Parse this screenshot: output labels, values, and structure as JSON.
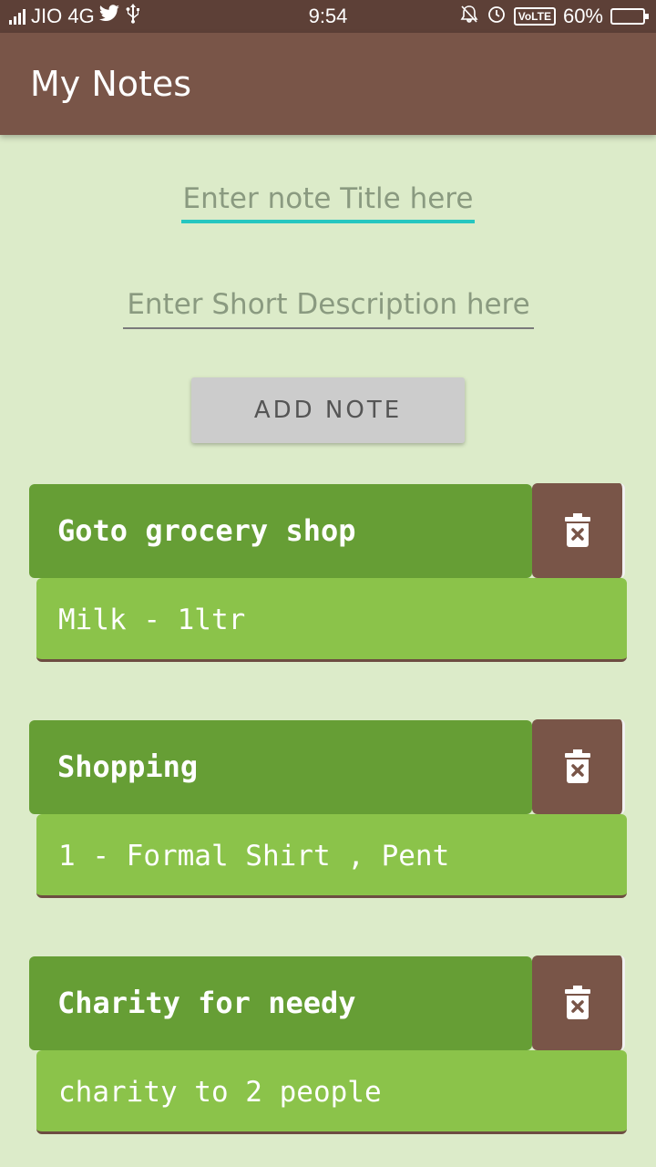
{
  "status_bar": {
    "carrier": "JIO 4G",
    "time": "9:54",
    "volte": "VoLTE",
    "battery": "60%",
    "battery_level": 0.6,
    "icons": [
      "signal-icon",
      "twitter-icon",
      "usb-icon",
      "mute-icon",
      "alarm-icon",
      "battery-icon"
    ]
  },
  "app_bar": {
    "title": "My Notes"
  },
  "form": {
    "title_placeholder": "Enter note Title here",
    "title_value": "",
    "description_placeholder": "Enter Short Description here",
    "description_value": "",
    "add_button_label": "ADD NOTE"
  },
  "notes": [
    {
      "title": "Goto grocery shop",
      "description": "Milk - 1ltr"
    },
    {
      "title": "Shopping",
      "description": "1 - Formal Shirt , Pent"
    },
    {
      "title": "Charity for needy",
      "description": "charity to 2 people"
    }
  ],
  "colors": {
    "status_bar": "#5d4037",
    "app_bar": "#795548",
    "background": "#dcebc9",
    "note_title_bg": "#669e35",
    "note_desc_bg": "#8bc34a",
    "delete_button_bg": "#795548",
    "accent": "#26c6c0"
  }
}
